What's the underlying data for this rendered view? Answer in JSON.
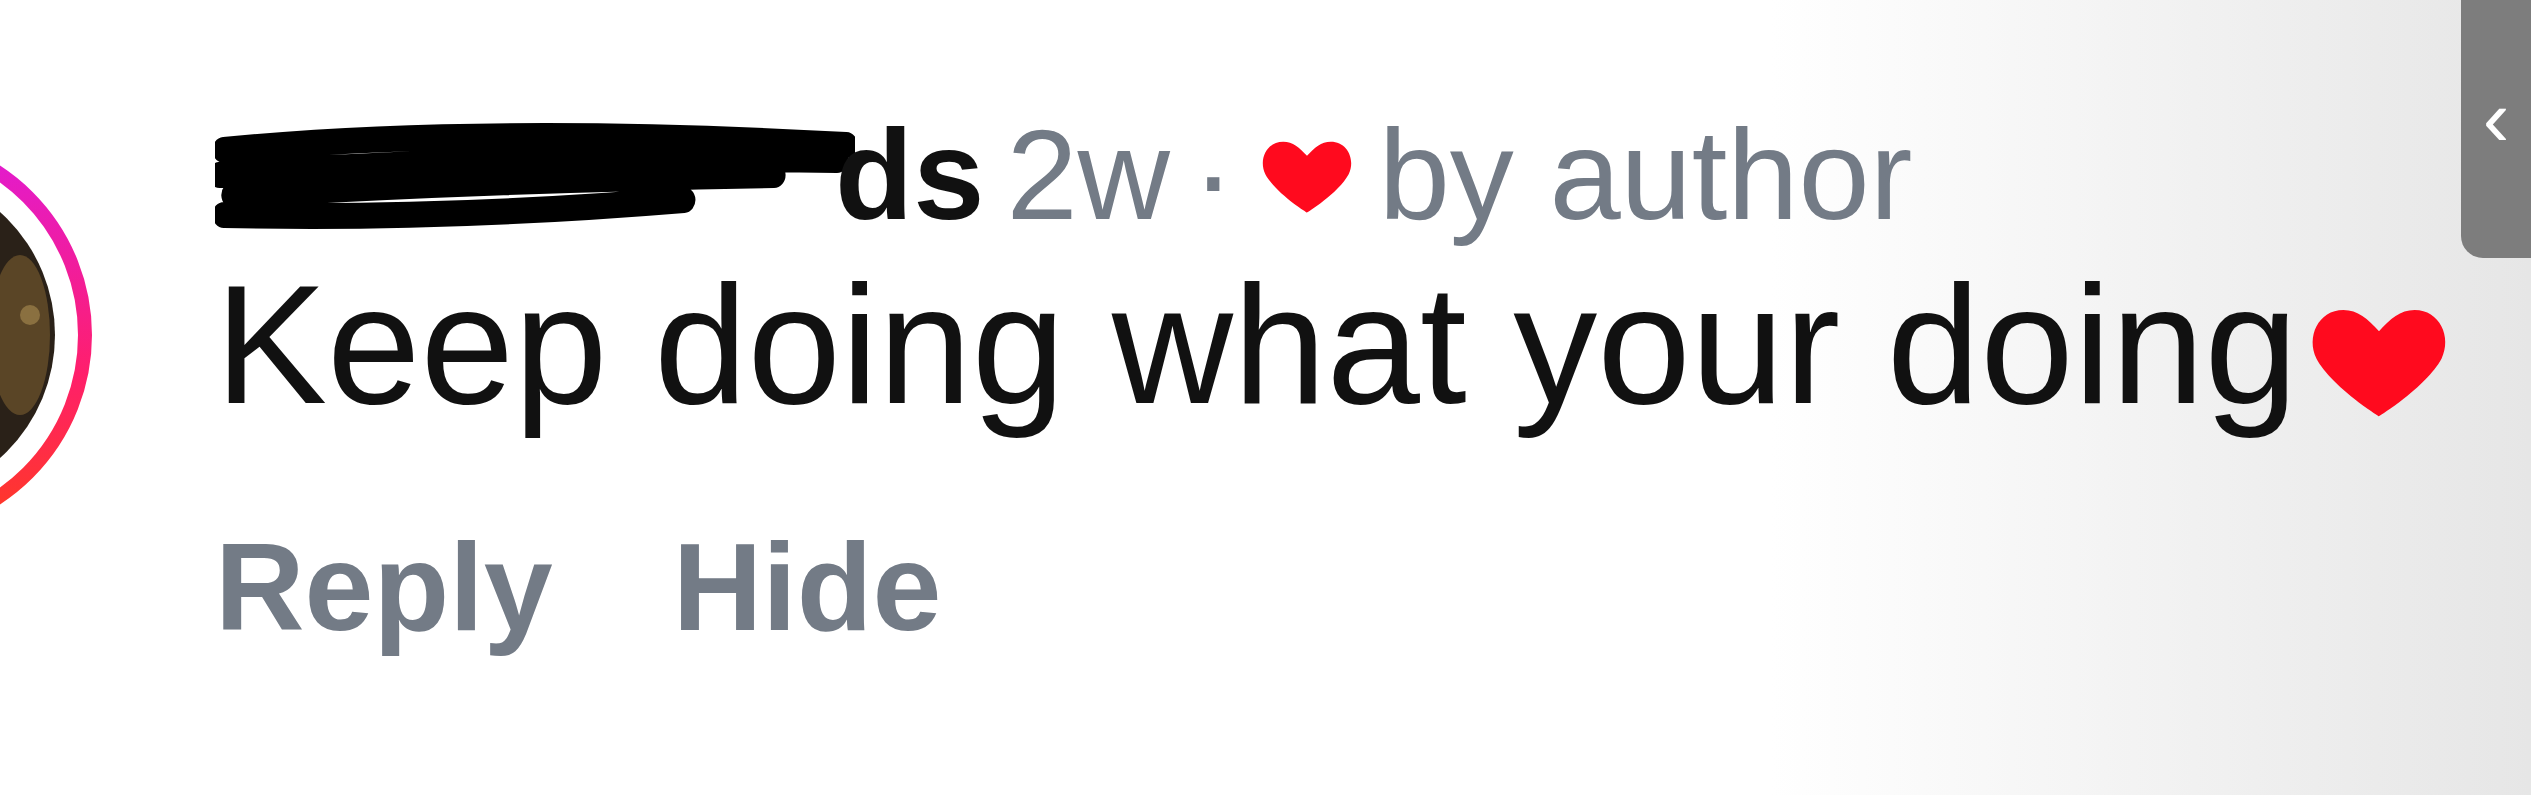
{
  "comment": {
    "username": "ds",
    "time": "2w",
    "separator": "·",
    "liked_by_author": true,
    "liked_label": "by author",
    "text": "Keep doing what your doing",
    "actions": [
      "Reply",
      "Hide"
    ]
  },
  "side_tab": {
    "icon": "‹"
  }
}
